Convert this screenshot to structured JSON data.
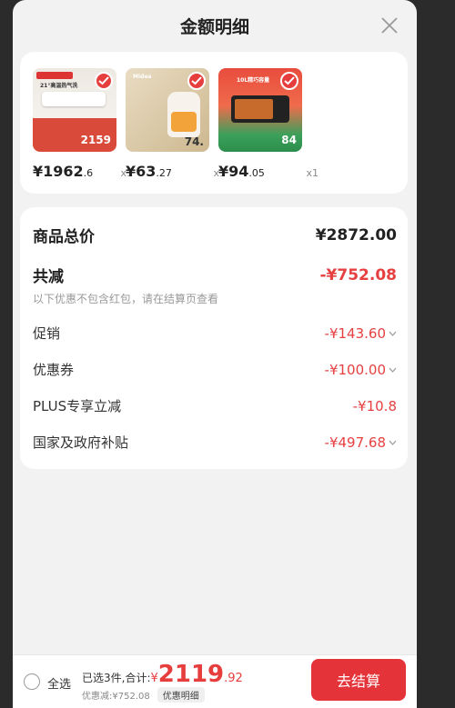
{
  "header": {
    "title": "金额明细"
  },
  "products": [
    {
      "price_main": "¥1962",
      "price_dec": ".6",
      "qty": "x1",
      "img_text": "21°高温热气洗",
      "img_price": "2159"
    },
    {
      "price_main": "¥63",
      "price_dec": ".27",
      "qty": "x1",
      "img_text": "Midea",
      "img_price": "74."
    },
    {
      "price_main": "¥94",
      "price_dec": ".05",
      "qty": "x1",
      "img_text": "10L精巧容量",
      "img_price": "84"
    }
  ],
  "details": {
    "total_label": "商品总价",
    "total_value": "¥2872.00",
    "reduce_label": "共减",
    "reduce_value": "-¥752.08",
    "note": "以下优惠不包含红包，请在结算页查看",
    "rows": [
      {
        "label": "促销",
        "value": "-¥143.60"
      },
      {
        "label": "优惠券",
        "value": "-¥100.00"
      },
      {
        "label": "PLUS专享立减",
        "value": "-¥10.8"
      },
      {
        "label": "国家及政府补贴",
        "value": "-¥497.68"
      }
    ]
  },
  "footer": {
    "select_all": "全选",
    "selected_text": "已选3件,合计:",
    "currency": "¥",
    "amount_int": "2119",
    "amount_dec": ".92",
    "discount_text": "优惠减:¥752.08",
    "detail_chip": "优惠明细",
    "checkout": "去结算"
  },
  "colors": {
    "accent": "#e5333a",
    "price_red": "#e64040",
    "background": "#f2f2f2"
  }
}
